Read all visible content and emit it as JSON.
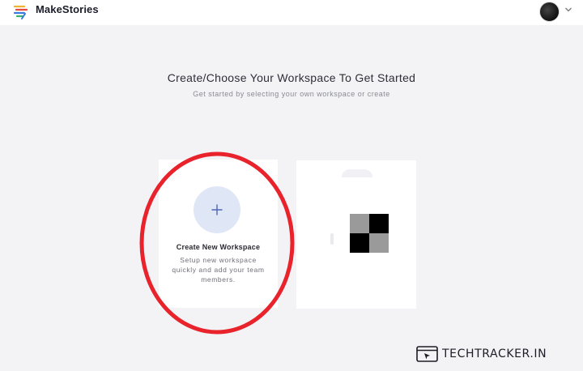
{
  "header": {
    "brand": "MakeStories",
    "logo_icon": "makestories-logo-icon",
    "avatar_icon": "user-avatar",
    "menu_icon": "chevron-down-icon"
  },
  "main": {
    "heading": "Create/Choose Your Workspace To Get Started",
    "subheading": "Get started by selecting your own workspace or create"
  },
  "cards": {
    "create": {
      "icon": "plus-icon",
      "title": "Create New Workspace",
      "description": "Setup new workspace quickly and add your team members."
    },
    "existing": {
      "thumbnail_icon": "workspace-thumbnail"
    }
  },
  "annotation": {
    "color": "#e8232c"
  },
  "watermark": {
    "text": "TECHTRACKER.IN",
    "icon": "browser-window-icon"
  },
  "colors": {
    "background": "#f3f3f6",
    "card": "#ffffff",
    "accent": "#4f67b8",
    "accent_soft": "#dfe6f6"
  }
}
